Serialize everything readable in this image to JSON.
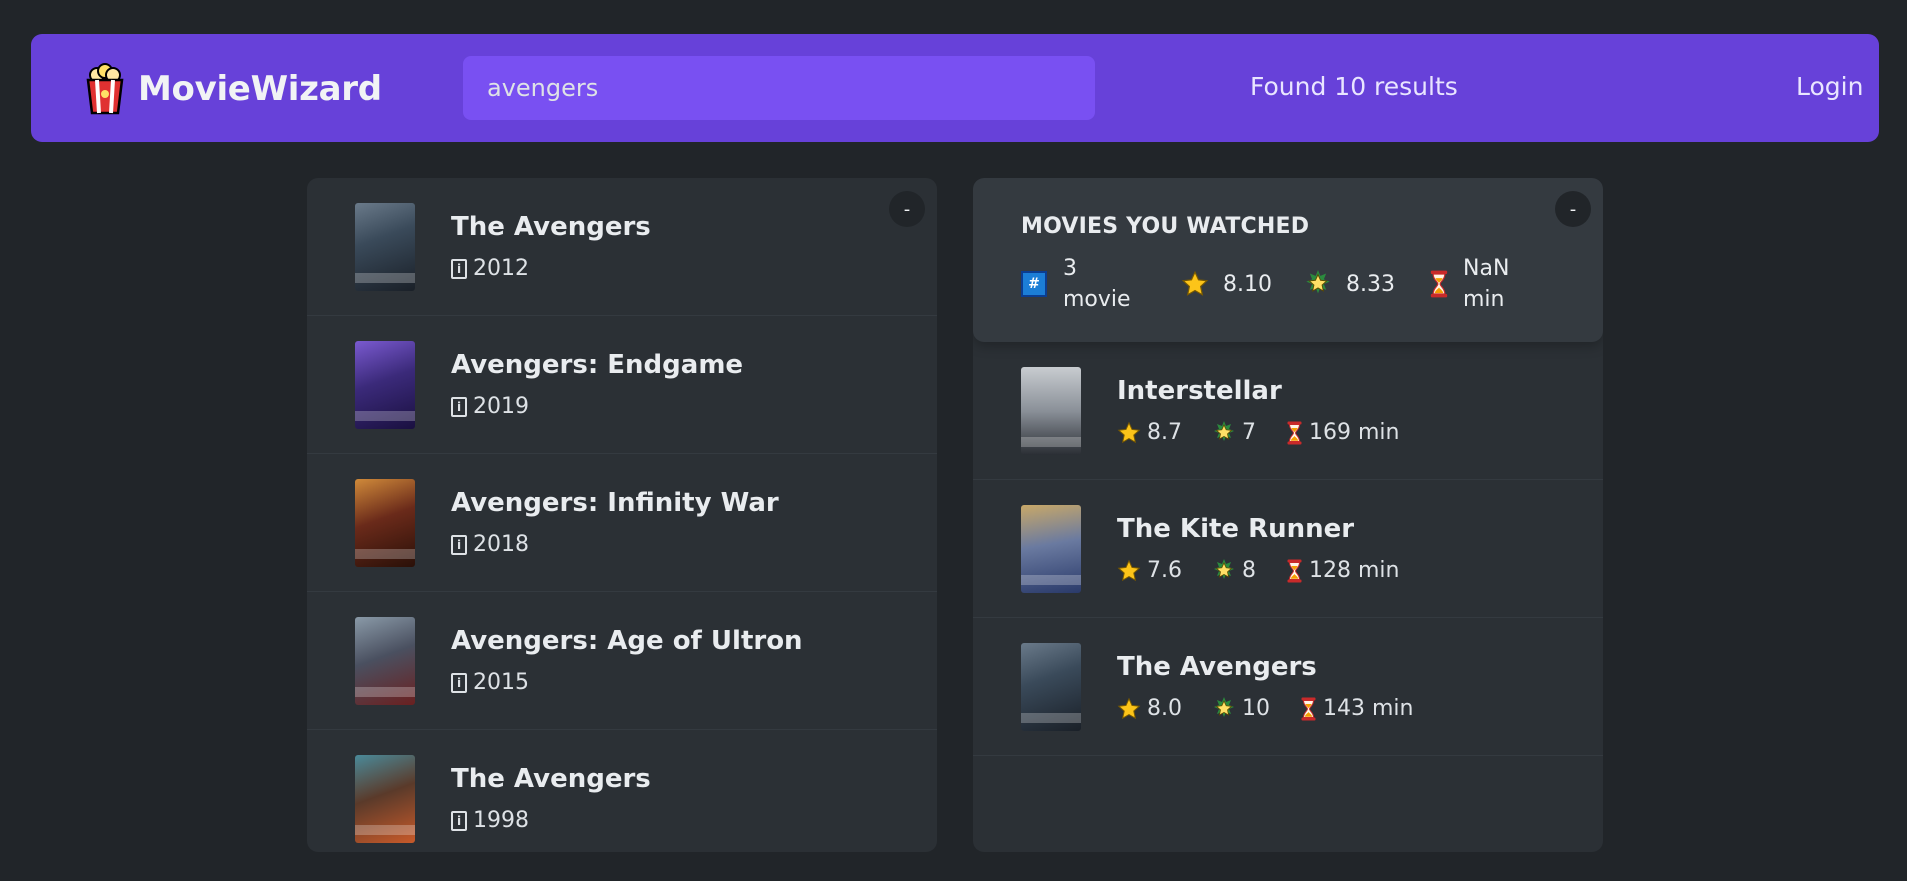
{
  "app": {
    "name": "MovieWizard"
  },
  "search": {
    "value": "avengers"
  },
  "results_text": "Found 10 results",
  "login_label": "Login",
  "toggle_label": "-",
  "results": [
    {
      "title": "The Avengers",
      "year": "2012",
      "poster_color": "#3a4a5a"
    },
    {
      "title": "Avengers: Endgame",
      "year": "2019",
      "poster_color": "#3b2a7a"
    },
    {
      "title": "Avengers: Infinity War",
      "year": "2018",
      "poster_color": "#6a2a1a"
    },
    {
      "title": "Avengers: Age of Ultron",
      "year": "2015",
      "poster_color": "#4a5060"
    },
    {
      "title": "The Avengers",
      "year": "1998",
      "poster_color": "#5a3a2a"
    }
  ],
  "summary": {
    "heading": "MOVIES YOU WATCHED",
    "count_value": "3",
    "count_unit": "movie",
    "avg_imdb": "8.10",
    "avg_user": "8.33",
    "avg_runtime_value": "NaN",
    "avg_runtime_unit": "min"
  },
  "watched": [
    {
      "title": "Interstellar",
      "imdb": "8.7",
      "user": "7",
      "runtime": "169 min",
      "poster_color": "#8a9098"
    },
    {
      "title": "The Kite Runner",
      "imdb": "7.6",
      "user": "8",
      "runtime": "128 min",
      "poster_color": "#6a7aa0"
    },
    {
      "title": "The Avengers",
      "imdb": "8.0",
      "user": "10",
      "runtime": "143 min",
      "poster_color": "#3a4a5a"
    }
  ],
  "icons": {
    "logo": "popcorn-icon",
    "year": "calendar-icon",
    "count": "hash-icon",
    "imdb": "star-icon",
    "user": "glowing-star-icon",
    "runtime": "hourglass-icon"
  },
  "colors": {
    "accent": "#6741d9",
    "search_bg": "#7950f2",
    "background": "#212529",
    "box": "#2b3035",
    "summary": "#343a40"
  }
}
